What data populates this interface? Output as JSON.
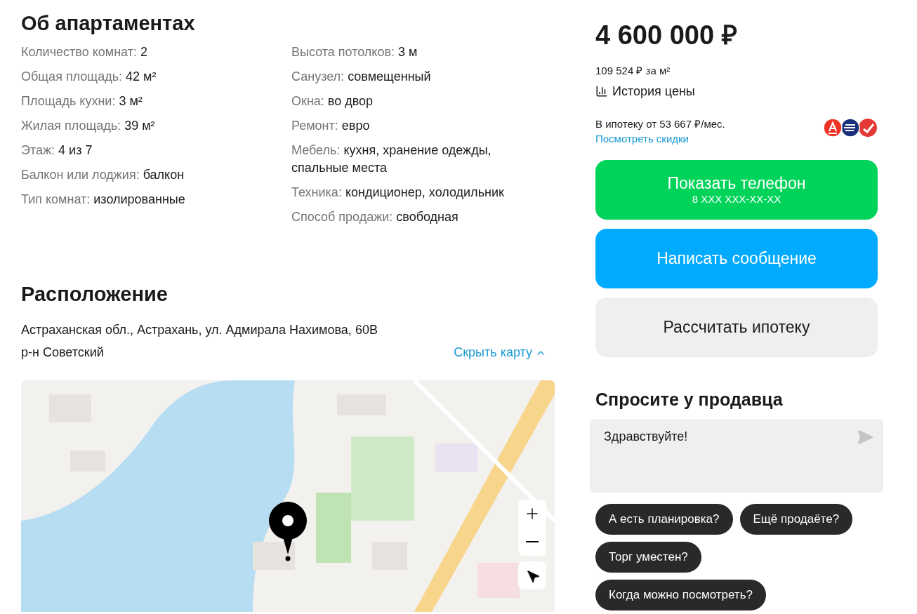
{
  "about": {
    "title": "Об апартаментах",
    "columns": [
      [
        {
          "label": "Количество комнат:",
          "value": "2"
        },
        {
          "label": "Общая площадь:",
          "value": "42 м²"
        },
        {
          "label": "Площадь кухни:",
          "value": "3 м²"
        },
        {
          "label": "Жилая площадь:",
          "value": "39 м²"
        },
        {
          "label": "Этаж:",
          "value": "4 из 7"
        },
        {
          "label": "Балкон или лоджия:",
          "value": "балкон"
        },
        {
          "label": "Тип комнат:",
          "value": "изолированные"
        }
      ],
      [
        {
          "label": "Высота потолков:",
          "value": "3 м"
        },
        {
          "label": "Санузел:",
          "value": "совмещенный"
        },
        {
          "label": "Окна:",
          "value": "во двор"
        },
        {
          "label": "Ремонт:",
          "value": "евро"
        },
        {
          "label": "Мебель:",
          "value": "кухня, хранение одежды, спальные места"
        },
        {
          "label": "Техника:",
          "value": "кондиционер, холодильник"
        },
        {
          "label": "Способ продажи:",
          "value": "свободная"
        }
      ]
    ]
  },
  "location": {
    "title": "Расположение",
    "address": "Астраханская обл., Астрахань, ул. Адмирала Нахимова, 60В",
    "district": "р-н Советский",
    "hide_map": "Скрыть карту"
  },
  "price": {
    "amount": "4 600 000 ₽",
    "per_meter": "109 524 ₽ за м²",
    "history": "История цены",
    "mortgage": "В ипотеку от 53 667 ₽/мес.",
    "discounts": "Посмотреть скидки"
  },
  "buttons": [
    {
      "kind": "phone",
      "label": "Показать телефон",
      "sub": "8 XXX XXX-XX-XX"
    },
    {
      "kind": "message",
      "label": "Написать сообщение"
    },
    {
      "kind": "mortgage",
      "label": "Рассчитать ипотеку"
    }
  ],
  "ask": {
    "title": "Спросите у продавца",
    "message": "Здравствуйте!",
    "chips": [
      "А есть планировка?",
      "Ещё продаёте?",
      "Торг уместен?",
      "Когда можно посмотреть?"
    ]
  }
}
